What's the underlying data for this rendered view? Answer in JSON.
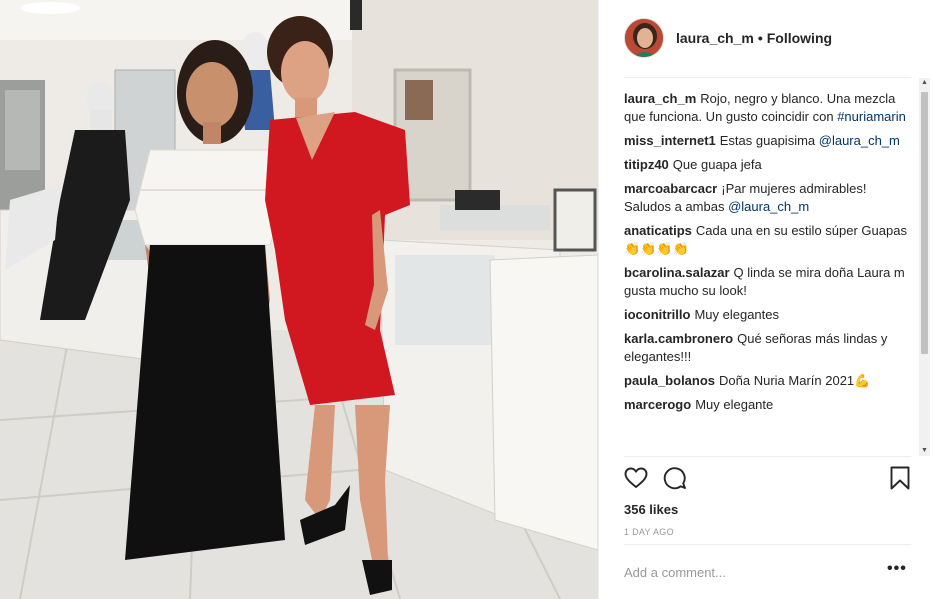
{
  "post": {
    "username": "laura_ch_m",
    "separator": "•",
    "follow_status": "Following",
    "avatar_icon": "profile-avatar",
    "photo_description_icon": "post-photo"
  },
  "comments": [
    {
      "user": "laura_ch_m",
      "text": "Rojo, negro y blanco. Una mezcla que funciona. Un gusto coincidir con ",
      "link": "#nuriamarin",
      "after": ""
    },
    {
      "user": "miss_internet1",
      "text": "Estas guapisima ",
      "link": "@laura_ch_m",
      "after": ""
    },
    {
      "user": "titipz40",
      "text": "Que guapa jefa",
      "link": "",
      "after": ""
    },
    {
      "user": "marcoabarcacr",
      "text": "¡Par mujeres admirables! Saludos a ambas ",
      "link": "@laura_ch_m",
      "after": ""
    },
    {
      "user": "anaticatips",
      "text": "Cada una en su estilo súper Guapas👏👏👏👏",
      "link": "",
      "after": ""
    },
    {
      "user": "bcarolina.salazar",
      "text": "Q linda se mira doña Laura m gusta mucho su look!",
      "link": "",
      "after": ""
    },
    {
      "user": "ioconitrillo",
      "text": "Muy elegantes",
      "link": "",
      "after": ""
    },
    {
      "user": "karla.cambronero",
      "text": "Qué señoras más lindas y elegantes!!!",
      "link": "",
      "after": ""
    },
    {
      "user": "paula_bolanos",
      "text": "Doña Nuria Marín 2021💪",
      "link": "",
      "after": ""
    },
    {
      "user": "marcerogo",
      "text": "Muy elegante",
      "link": "",
      "after": ""
    }
  ],
  "actions": {
    "like_icon": "heart-icon",
    "comment_icon": "comment-icon",
    "save_icon": "bookmark-icon"
  },
  "likes": "356 likes",
  "time": "1 DAY AGO",
  "comment_input": {
    "placeholder": "Add a comment...",
    "value": ""
  },
  "more_label": "•••",
  "colors": {
    "link": "#003569",
    "text": "#262626",
    "muted": "#999999",
    "divider": "#efefef"
  }
}
